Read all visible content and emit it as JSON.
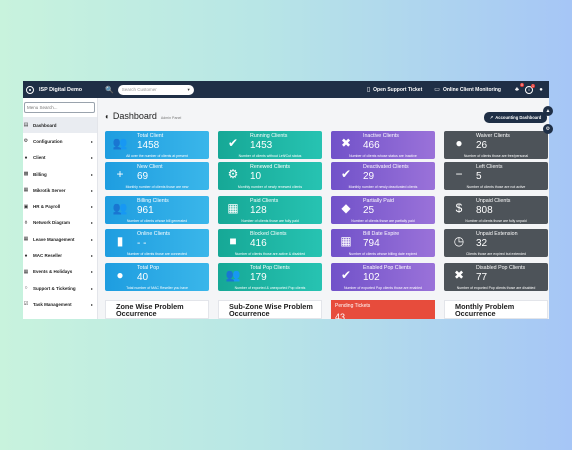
{
  "topbar": {
    "brand": "ISP Digital Demo",
    "search_placeholder": "Search Customer",
    "support_label": "Open Support Ticket",
    "monitor_label": "Online Client Monitoring",
    "notif_count": "0",
    "info_count": "1"
  },
  "sidebar": {
    "search_placeholder": "Menu Search...",
    "items": [
      {
        "label": "Dashboard"
      },
      {
        "label": "Configuration"
      },
      {
        "label": "Client"
      },
      {
        "label": "Billing"
      },
      {
        "label": "Mikrotik Server"
      },
      {
        "label": "HR & Payroll"
      },
      {
        "label": "Network Diagram"
      },
      {
        "label": "Leave Management"
      },
      {
        "label": "MAC Reseller"
      },
      {
        "label": "Events & Holidays"
      },
      {
        "label": "Support & Ticketing"
      },
      {
        "label": "Task Management"
      }
    ]
  },
  "main": {
    "title": "Dashboard",
    "crumb": "Admin Panel",
    "accounting_label": "Accounting Dashboard",
    "cards": [
      {
        "label": "Total Client",
        "value": "1458",
        "desc": "All over the number of clients at present",
        "color": "blue"
      },
      {
        "label": "Running Clients",
        "value": "1453",
        "desc": "Number of clients without Left/Cut status",
        "color": "teal"
      },
      {
        "label": "Inactive Clients",
        "value": "466",
        "desc": "Number of clients whose status are Inactive",
        "color": "purple"
      },
      {
        "label": "Waiver Clients",
        "value": "26",
        "desc": "Number of clients those are free/personal",
        "color": "gray"
      },
      {
        "label": "New Client",
        "value": "69",
        "desc": "Monthly number of clients those are new",
        "color": "blue"
      },
      {
        "label": "Renewed Clients",
        "value": "10",
        "desc": "Monthly number of newly renewed clients",
        "color": "teal"
      },
      {
        "label": "Deactivated Clients",
        "value": "29",
        "desc": "Monthly number of newly deactivated clients",
        "color": "purple"
      },
      {
        "label": "Left Clients",
        "value": "5",
        "desc": "Number of clients those are not active",
        "color": "gray"
      },
      {
        "label": "Billing Clients",
        "value": "961",
        "desc": "Number of clients whose bill generated",
        "color": "blue"
      },
      {
        "label": "Paid Clients",
        "value": "128",
        "desc": "Number of clients those are fully paid",
        "color": "teal"
      },
      {
        "label": "Partially Paid",
        "value": "25",
        "desc": "Number of clients those are partially paid",
        "color": "purple"
      },
      {
        "label": "Unpaid Clients",
        "value": "808",
        "desc": "Number of clients those are fully unpaid",
        "color": "gray"
      },
      {
        "label": "Online Clients",
        "value": "- -",
        "desc": "Number of clients those are connected",
        "color": "blue"
      },
      {
        "label": "Blocked Clients",
        "value": "416",
        "desc": "Number of clients those are active & disabled",
        "color": "teal"
      },
      {
        "label": "Bill Date Expire",
        "value": "794",
        "desc": "Number of clients whose billing date expired",
        "color": "purple"
      },
      {
        "label": "Unpaid Extension",
        "value": "32",
        "desc": "Clients those are expired but extended",
        "color": "gray"
      },
      {
        "label": "Total Pop",
        "value": "40",
        "desc": "Total number of MAC Reseller you have",
        "color": "blue"
      },
      {
        "label": "Total Pop Clients",
        "value": "179",
        "desc": "Number of exported & unexported Pop clients",
        "color": "teal"
      },
      {
        "label": "Enabled Pop Clients",
        "value": "102",
        "desc": "Number of exported Pop clients those are enabled",
        "color": "purple"
      },
      {
        "label": "Disabled Pop Clients",
        "value": "77",
        "desc": "Number of exported Pop clients those are disabled",
        "color": "gray"
      }
    ],
    "panels": [
      {
        "title": "Zone Wise Problem Occurrence"
      },
      {
        "title": "Sub-Zone Wise Problem Occurrence"
      },
      {
        "title": "Pending Tickets",
        "value": "43"
      },
      {
        "title": "Monthly Problem Occurrence"
      }
    ]
  }
}
